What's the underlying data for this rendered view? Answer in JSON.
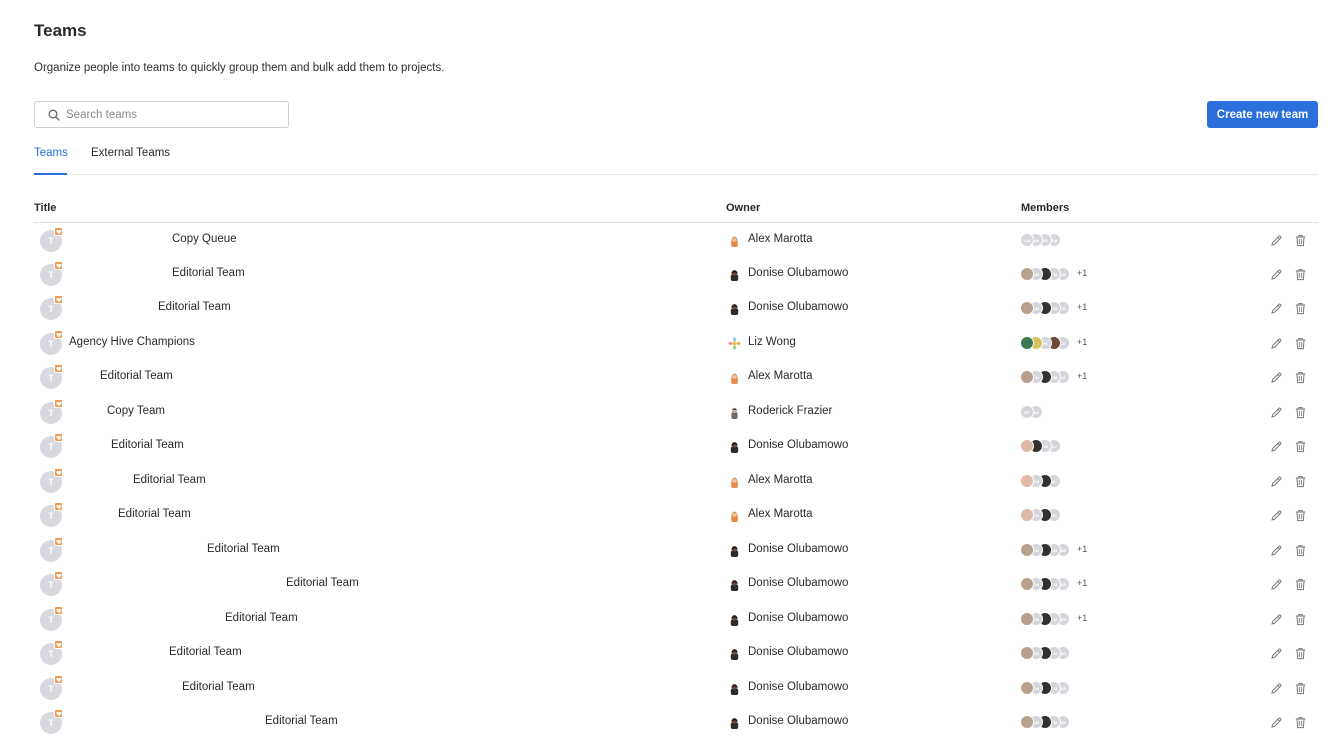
{
  "header": {
    "title": "Teams",
    "subtitle": "Organize people into teams to quickly group them and bulk add them to projects."
  },
  "search": {
    "placeholder": "Search teams",
    "value": ""
  },
  "actions": {
    "create_label": "Create new team"
  },
  "tabs": [
    {
      "label": "Teams",
      "active": true
    },
    {
      "label": "External Teams",
      "active": false
    }
  ],
  "table": {
    "columns": {
      "title": "Title",
      "owner": "Owner",
      "members": "Members"
    },
    "rows": [
      {
        "avatar": "T",
        "title": "Copy Queue",
        "owner": "Alex Marotta",
        "owner_style": "alex",
        "members": [
          "AM",
          "NM",
          "BS",
          "KM"
        ],
        "more": ""
      },
      {
        "avatar": "T",
        "title": "Editorial Team",
        "owner": "Donise Olubamowo",
        "owner_style": "donise",
        "members": [
          "photo-a",
          "CM",
          "photo-b",
          "CM",
          "LB"
        ],
        "more": "+1"
      },
      {
        "avatar": "T",
        "title": "Editorial Team",
        "owner": "Donise Olubamowo",
        "owner_style": "donise",
        "members": [
          "photo-a",
          "CM",
          "photo-b",
          "CM",
          "LB"
        ],
        "more": "+1"
      },
      {
        "avatar": "T",
        "title": "Agency Hive Champions",
        "owner": "Liz Wong",
        "owner_style": "liz",
        "members": [
          "photo-d",
          "photo-e",
          "HS",
          "photo-f",
          "CB"
        ],
        "more": "+1"
      },
      {
        "avatar": "T",
        "title": "Editorial Team",
        "owner": "Alex Marotta",
        "owner_style": "alex",
        "members": [
          "photo-a",
          "CM",
          "photo-b",
          "CM",
          "LB"
        ],
        "more": "+1"
      },
      {
        "avatar": "T",
        "title": "Copy Team",
        "owner": "Roderick Frazier",
        "owner_style": "roderick",
        "members": [
          "RF",
          "JM"
        ],
        "more": ""
      },
      {
        "avatar": "T",
        "title": "Editorial Team",
        "owner": "Donise Olubamowo",
        "owner_style": "donise",
        "members": [
          "photo-c",
          "photo-b",
          "CM",
          "BC"
        ],
        "more": ""
      },
      {
        "avatar": "T",
        "title": "Editorial Team",
        "owner": "Alex Marotta",
        "owner_style": "alex",
        "members": [
          "photo-c",
          "CM",
          "photo-b",
          "BC"
        ],
        "more": ""
      },
      {
        "avatar": "T",
        "title": "Editorial Team",
        "owner": "Alex Marotta",
        "owner_style": "alex",
        "members": [
          "photo-c",
          "CM",
          "photo-b",
          "BC"
        ],
        "more": ""
      },
      {
        "avatar": "T",
        "title": "Editorial Team",
        "owner": "Donise Olubamowo",
        "owner_style": "donise",
        "members": [
          "photo-a",
          "CM",
          "photo-b",
          "CM",
          "MB"
        ],
        "more": "+1"
      },
      {
        "avatar": "T",
        "title": "Editorial Team",
        "owner": "Donise Olubamowo",
        "owner_style": "donise",
        "members": [
          "photo-a",
          "CM",
          "photo-b",
          "CM",
          "MB"
        ],
        "more": "+1"
      },
      {
        "avatar": "T",
        "title": "Editorial Team",
        "owner": "Donise Olubamowo",
        "owner_style": "donise",
        "members": [
          "photo-a",
          "CM",
          "photo-b",
          "CM",
          "MB"
        ],
        "more": "+1"
      },
      {
        "avatar": "T",
        "title": "Editorial Team",
        "owner": "Donise Olubamowo",
        "owner_style": "donise",
        "members": [
          "photo-a",
          "CM",
          "photo-b",
          "CM",
          "MB"
        ],
        "more": ""
      },
      {
        "avatar": "T",
        "title": "Editorial Team",
        "owner": "Donise Olubamowo",
        "owner_style": "donise",
        "members": [
          "photo-a",
          "CM",
          "photo-b",
          "CM",
          "MB"
        ],
        "more": ""
      },
      {
        "avatar": "T",
        "title": "Editorial Team",
        "owner": "Donise Olubamowo",
        "owner_style": "donise",
        "members": [
          "photo-a",
          "CM",
          "photo-b",
          "CM",
          "MB"
        ],
        "more": ""
      }
    ]
  },
  "colors": {
    "accent": "#2a6fdb",
    "badge": "#f09a52",
    "avatar_placeholder": "#d7d9df"
  },
  "icons": {
    "search": "search-icon",
    "edit": "pencil-icon",
    "delete": "trash-icon",
    "badge": "heart-icon"
  }
}
